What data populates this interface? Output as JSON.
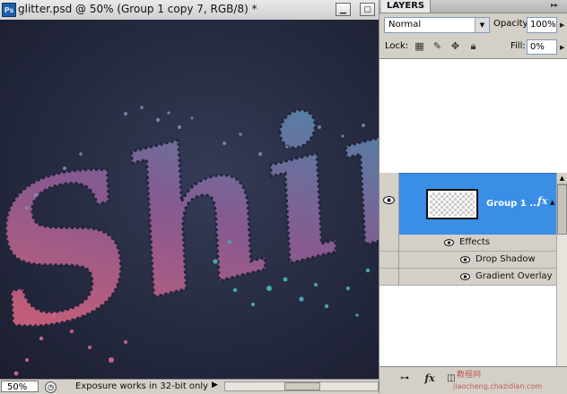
{
  "document": {
    "app_icon": "Ps",
    "title": "glitter.psd @ 50% (Group 1 copy 7, RGB/8) *",
    "artwork_text": "Shin",
    "canvas_colors": {
      "bg_center": "#353b57",
      "bg_edge": "#1b1e2f",
      "gradient_start": "#d05f78",
      "gradient_end": "#3fa8b3"
    }
  },
  "status_bar": {
    "zoom": "50%",
    "info_text": "Exposure works in 32-bit only",
    "arrow": "▶"
  },
  "layers_panel": {
    "tab_label": "LAYERS",
    "menu_icon": "▸▸",
    "blend_mode": "Normal",
    "opacity_label": "Opacity:",
    "opacity_value": "100%",
    "lock_label": "Lock:",
    "fill_label": "Fill:",
    "fill_value": "0%",
    "selected_layer": {
      "name": "Group 1 ...",
      "fx": "fx",
      "color": "#3a8ee6"
    },
    "effects_label": "Effects",
    "effects": [
      "Drop Shadow",
      "Gradient Overlay"
    ],
    "footer_icons": [
      "link-icon",
      "fx-icon",
      "mask-icon"
    ],
    "footer_fx": "fx",
    "watermark_line1": "教程网",
    "watermark_line2": "jiaocheng.chazidian.com"
  }
}
